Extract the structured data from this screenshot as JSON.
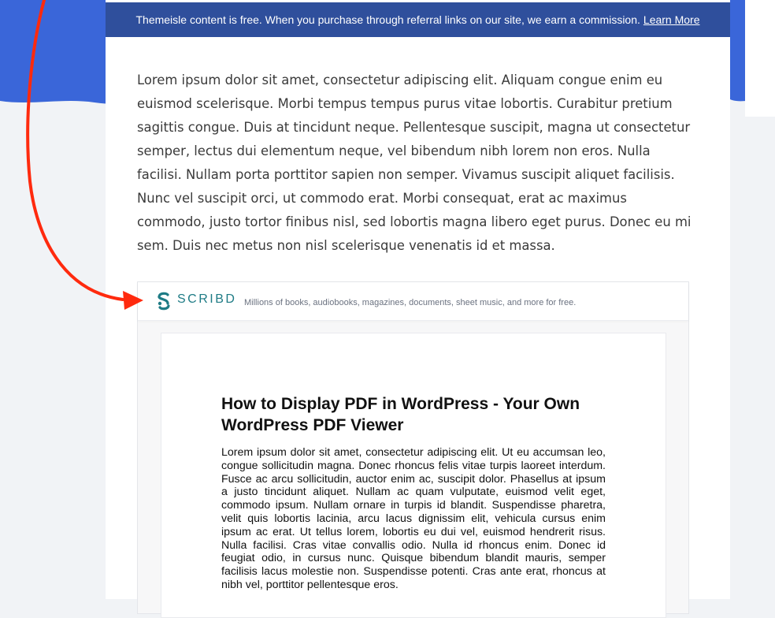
{
  "notice": {
    "text": "Themeisle content is free. When you purchase through referral links on our site, we earn a commission.",
    "link_label": "Learn More"
  },
  "article": {
    "paragraph": "Lorem ipsum dolor sit amet, consectetur adipiscing elit. Aliquam congue enim eu euismod scelerisque. Morbi tempus tempus purus vitae lobortis. Curabitur pretium sagittis congue. Duis at tincidunt neque. Pellentesque suscipit, magna ut consectetur semper, lectus dui elementum neque, vel bibendum nibh lorem non eros. Nulla facilisi. Nullam porta porttitor sapien non semper. Vivamus suscipit aliquet facilisis. Nunc vel suscipit orci, ut commodo erat. Morbi consequat, erat ac maximus commodo, justo tortor finibus nisl, sed lobortis magna libero eget purus. Donec eu mi sem. Duis nec metus non nisl scelerisque venenatis id et massa."
  },
  "scribd": {
    "brand": "SCRIBD",
    "tagline": "Millions of books, audiobooks, magazines, documents, sheet music, and more for free.",
    "icon": "scribd-logo-icon"
  },
  "document": {
    "title": "How to Display PDF in WordPress - Your Own WordPress PDF Viewer",
    "body": "Lorem ipsum dolor sit amet, consectetur adipiscing elit. Ut eu accumsan leo, congue sollicitudin magna. Donec rhoncus felis vitae turpis laoreet interdum. Fusce ac arcu sollicitudin, auctor enim ac, suscipit dolor. Phasellus at ipsum a justo tincidunt aliquet. Nullam ac quam vulputate, euismod velit eget, commodo ipsum. Nullam ornare in turpis id blandit. Suspendisse pharetra, velit quis lobortis lacinia, arcu lacus dignissim elit, vehicula cursus enim ipsum ac erat. Ut tellus lorem, lobortis eu dui vel, euismod hendrerit risus. Nulla facilisi. Cras vitae convallis odio. Nulla id rhoncus enim. Donec id feugiat odio, in cursus nunc. Quisque bibendum blandit mauris, semper facilisis lacus molestie non. Suspendisse potenti. Cras ante erat, rhoncus at nibh vel, porttitor pellentesque eros."
  },
  "colors": {
    "hero": "#3a66d9",
    "notice_bg": "#2f4f9c",
    "scribd_teal": "#1e7b85",
    "annotation_red": "#ff2a0e"
  }
}
